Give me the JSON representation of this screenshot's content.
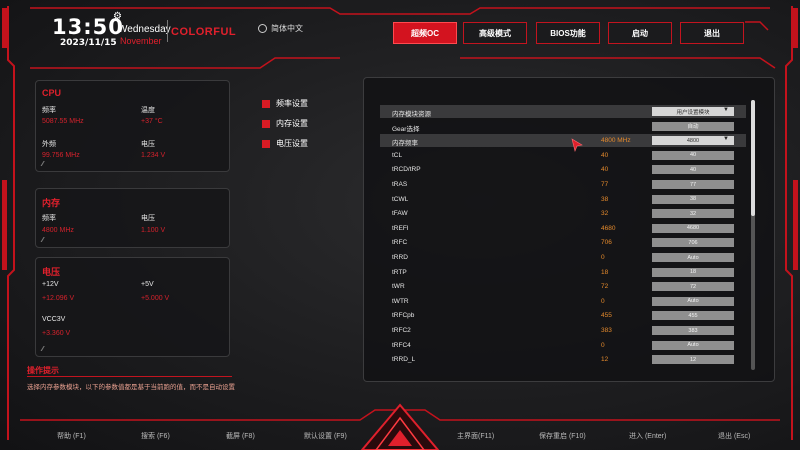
{
  "header": {
    "time": "13:50",
    "date": "2023/11/15",
    "weekday": "Wednesday",
    "month": "November",
    "brand": "COLORFUL",
    "language": "简体中文",
    "tabs": [
      {
        "label": "超频OC",
        "active": true
      },
      {
        "label": "高级模式",
        "active": false
      },
      {
        "label": "BIOS功能",
        "active": false
      },
      {
        "label": "启动",
        "active": false
      },
      {
        "label": "退出",
        "active": false
      }
    ]
  },
  "cpu_panel": {
    "title": "CPU",
    "freq_label": "频率",
    "freq_value": "5087.55 MHz",
    "temp_label": "温度",
    "temp_value": "+37 °C",
    "ext_label": "外频",
    "ext_value": "99.756 MHz",
    "volt_label": "电压",
    "volt_value": "1.234 V"
  },
  "mem_panel": {
    "title": "内存",
    "freq_label": "频率",
    "freq_value": "4800 MHz",
    "volt_label": "电压",
    "volt_value": "1.100 V"
  },
  "volt_panel": {
    "title": "电压",
    "v12_label": "+12V",
    "v12_value": "+12.096 V",
    "v5_label": "+5V",
    "v5_value": "+5.000 V",
    "vcc_label": "VCC3V",
    "vcc_value": "+3.360 V"
  },
  "menu": [
    {
      "label": "频率设置"
    },
    {
      "label": "内存设置"
    },
    {
      "label": "电压设置"
    }
  ],
  "settings": [
    {
      "name": "内存模块资源",
      "value": "",
      "box": "用户设置模块",
      "dropdown": true,
      "highlight": true
    },
    {
      "name": "Gear选择",
      "value": "",
      "box": "自动",
      "dropdown": false,
      "highlight": false
    },
    {
      "name": "内存频率",
      "value": "4800 MHz",
      "box": "4800",
      "dropdown": true,
      "highlight": true
    },
    {
      "name": "tCL",
      "value": "40",
      "box": "40",
      "dropdown": false,
      "highlight": false
    },
    {
      "name": "tRCD/tRP",
      "value": "40",
      "box": "40",
      "dropdown": false,
      "highlight": false
    },
    {
      "name": "tRAS",
      "value": "77",
      "box": "77",
      "dropdown": false,
      "highlight": false
    },
    {
      "name": "tCWL",
      "value": "38",
      "box": "38",
      "dropdown": false,
      "highlight": false
    },
    {
      "name": "tFAW",
      "value": "32",
      "box": "32",
      "dropdown": false,
      "highlight": false
    },
    {
      "name": "tREFI",
      "value": "4680",
      "box": "4680",
      "dropdown": false,
      "highlight": false
    },
    {
      "name": "tRFC",
      "value": "706",
      "box": "706",
      "dropdown": false,
      "highlight": false
    },
    {
      "name": "tRRD",
      "value": "0",
      "box": "Auto",
      "dropdown": false,
      "highlight": false
    },
    {
      "name": "tRTP",
      "value": "18",
      "box": "18",
      "dropdown": false,
      "highlight": false
    },
    {
      "name": "tWR",
      "value": "72",
      "box": "72",
      "dropdown": false,
      "highlight": false
    },
    {
      "name": "tWTR",
      "value": "0",
      "box": "Auto",
      "dropdown": false,
      "highlight": false
    },
    {
      "name": "tRFCpb",
      "value": "455",
      "box": "455",
      "dropdown": false,
      "highlight": false
    },
    {
      "name": "tRFC2",
      "value": "383",
      "box": "383",
      "dropdown": false,
      "highlight": false
    },
    {
      "name": "tRFC4",
      "value": "0",
      "box": "Auto",
      "dropdown": false,
      "highlight": false
    },
    {
      "name": "tRRD_L",
      "value": "12",
      "box": "12",
      "dropdown": false,
      "highlight": false
    }
  ],
  "tips": {
    "title": "操作提示",
    "text": "选择内存参数模块，以下的参数值都是基于当前跑的值，而不是自动设置"
  },
  "footer": [
    {
      "label": "帮助 (F1)"
    },
    {
      "label": "搜索 (F6)"
    },
    {
      "label": "截屏 (F8)"
    },
    {
      "label": "默认设置 (F9)"
    },
    {
      "label": "主界面(F11)"
    },
    {
      "label": "保存重启 (F10)"
    },
    {
      "label": "进入 (Enter)"
    },
    {
      "label": "退出 (Esc)"
    }
  ],
  "colors": {
    "accent": "#d3131f",
    "value_orange": "#e58a2c",
    "panel_bg": "#161618"
  }
}
